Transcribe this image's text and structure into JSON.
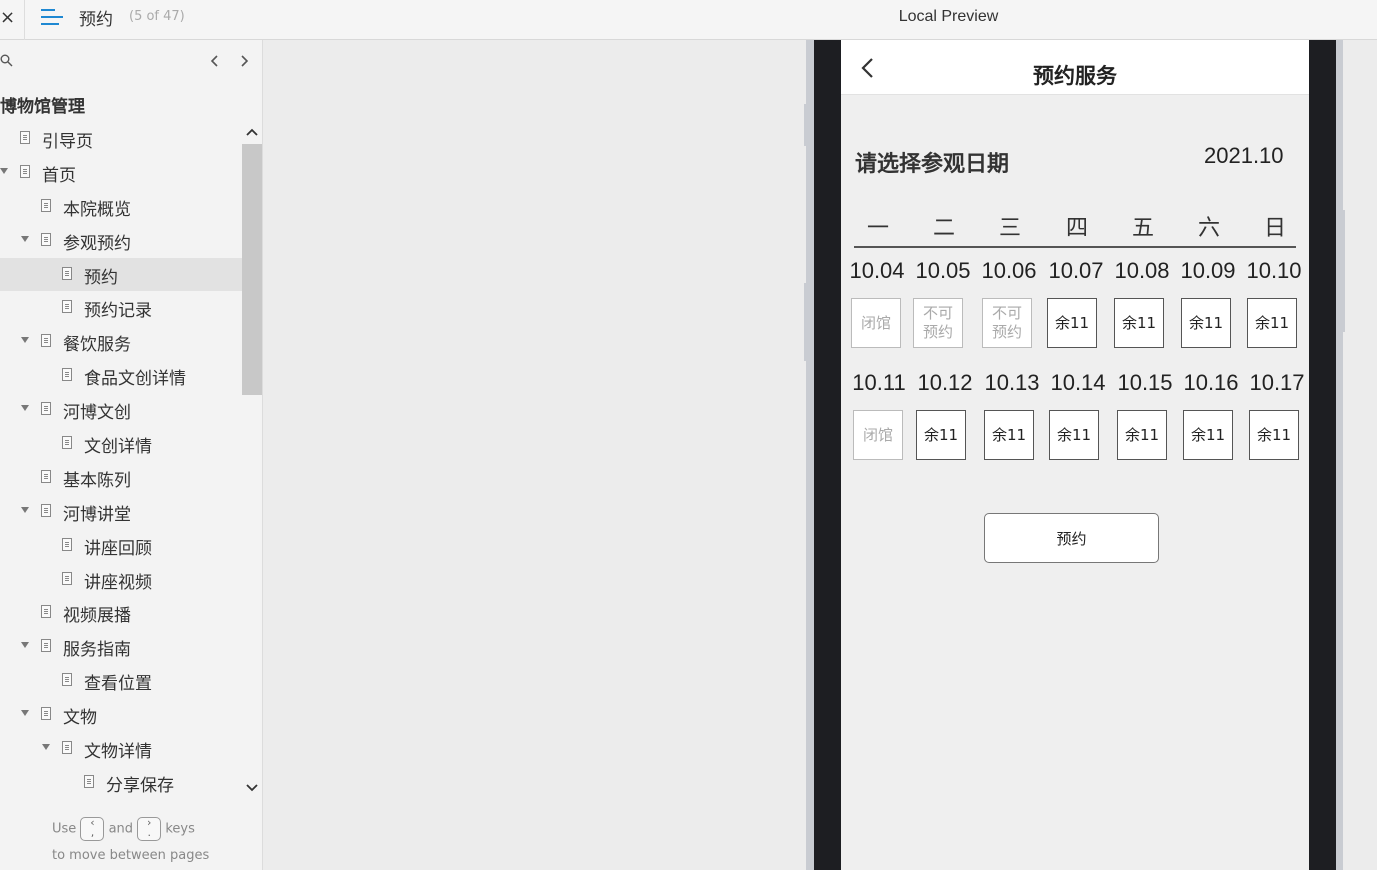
{
  "topbar": {
    "close_label": "×",
    "page_name": "预约",
    "page_count": "(5 of 47)",
    "preview_title": "Local Preview"
  },
  "sidebar": {
    "title": "博物馆管理",
    "items": [
      {
        "label": "引导页",
        "level": 0,
        "caret": false
      },
      {
        "label": "首页",
        "level": 0,
        "caret": true
      },
      {
        "label": "本院概览",
        "level": 1,
        "caret": false
      },
      {
        "label": "参观预约",
        "level": 1,
        "caret": true
      },
      {
        "label": "预约",
        "level": 2,
        "caret": false,
        "selected": true
      },
      {
        "label": "预约记录",
        "level": 2,
        "caret": false
      },
      {
        "label": "餐饮服务",
        "level": 1,
        "caret": true
      },
      {
        "label": "食品文创详情",
        "level": 2,
        "caret": false
      },
      {
        "label": "河博文创",
        "level": 1,
        "caret": true
      },
      {
        "label": "文创详情",
        "level": 2,
        "caret": false
      },
      {
        "label": "基本陈列",
        "level": 1,
        "caret": false
      },
      {
        "label": "河博讲堂",
        "level": 1,
        "caret": true
      },
      {
        "label": "讲座回顾",
        "level": 2,
        "caret": false
      },
      {
        "label": "讲座视频",
        "level": 2,
        "caret": false
      },
      {
        "label": "视频展播",
        "level": 1,
        "caret": false
      },
      {
        "label": "服务指南",
        "level": 1,
        "caret": true
      },
      {
        "label": "查看位置",
        "level": 2,
        "caret": false
      },
      {
        "label": "文物",
        "level": 1,
        "caret": true
      },
      {
        "label": "文物详情",
        "level": 2,
        "caret": true
      },
      {
        "label": "分享保存",
        "level": 3,
        "caret": false
      }
    ],
    "hint": {
      "use": "Use",
      "and": "and",
      "keys": "keys",
      "line2": "to move between pages"
    }
  },
  "app": {
    "title": "预约服务",
    "select_label": "请选择参观日期",
    "month": "2021.10",
    "weekdays": [
      "一",
      "二",
      "三",
      "四",
      "五",
      "六",
      "日"
    ],
    "weeks": [
      {
        "dates": [
          "10.04",
          "10.05",
          "10.06",
          "10.07",
          "10.08",
          "10.09",
          "10.10"
        ],
        "slots": [
          {
            "text": "闭馆",
            "available": false
          },
          {
            "text": "不可预约",
            "available": false
          },
          {
            "text": "不可预约",
            "available": false
          },
          {
            "text": "余11",
            "available": true
          },
          {
            "text": "余11",
            "available": true
          },
          {
            "text": "余11",
            "available": true
          },
          {
            "text": "余11",
            "available": true
          }
        ]
      },
      {
        "dates": [
          "10.11",
          "10.12",
          "10.13",
          "10.14",
          "10.15",
          "10.16",
          "10.17"
        ],
        "slots": [
          {
            "text": "闭馆",
            "available": false
          },
          {
            "text": "余11",
            "available": true
          },
          {
            "text": "余11",
            "available": true
          },
          {
            "text": "余11",
            "available": true
          },
          {
            "text": "余11",
            "available": true
          },
          {
            "text": "余11",
            "available": true
          },
          {
            "text": "余11",
            "available": true
          }
        ]
      }
    ],
    "reserve_button": "预约"
  }
}
